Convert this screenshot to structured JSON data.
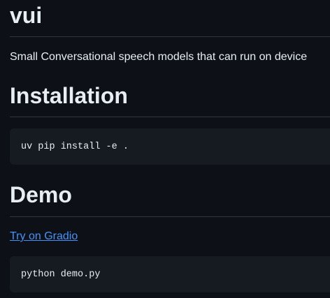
{
  "readme": {
    "title": "vui",
    "description": "Small Conversational speech models that can run on device",
    "sections": {
      "installation": {
        "heading": "Installation",
        "code": "uv pip install -e ."
      },
      "demo": {
        "heading": "Demo",
        "link_text": "Try on Gradio",
        "code": "python demo.py"
      }
    }
  },
  "colors": {
    "background": "#0d1117",
    "text": "#e6edf3",
    "link": "#4493f8",
    "code_background": "#161b22",
    "divider": "#30363d"
  }
}
